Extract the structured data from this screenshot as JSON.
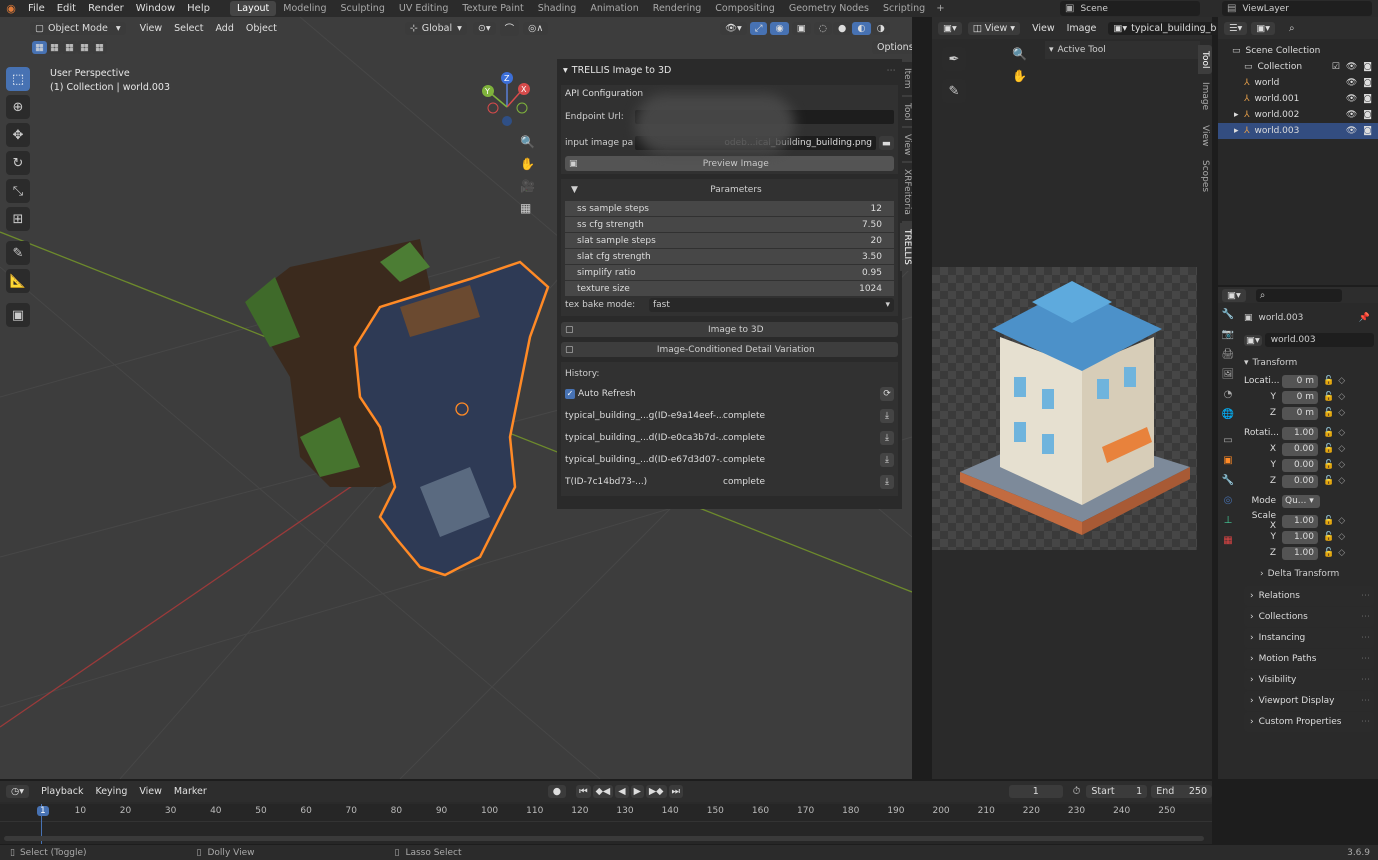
{
  "topbar": {
    "menus": [
      "File",
      "Edit",
      "Render",
      "Window",
      "Help"
    ],
    "workspaces": [
      "Layout",
      "Modeling",
      "Sculpting",
      "UV Editing",
      "Texture Paint",
      "Shading",
      "Animation",
      "Rendering",
      "Compositing",
      "Geometry Nodes",
      "Scripting"
    ],
    "scene": "Scene",
    "viewlayer": "ViewLayer"
  },
  "viewport": {
    "mode": "Object Mode",
    "menus": [
      "View",
      "Select",
      "Add",
      "Object"
    ],
    "transform": "Global",
    "options": "Options",
    "perspective": "User Perspective",
    "collection": "(1) Collection | world.003"
  },
  "npanel": {
    "title": "TRELLIS Image to 3D",
    "api_config": "API Configuration",
    "endpoint_label": "Endpoint Url:",
    "image_path_label": "input image pa",
    "image_path_value": "odeb...ical_building_building.png",
    "preview_button": "Preview Image",
    "parameters_label": "Parameters",
    "params": [
      {
        "label": "ss sample steps",
        "value": "12"
      },
      {
        "label": "ss cfg strength",
        "value": "7.50"
      },
      {
        "label": "slat sample steps",
        "value": "20"
      },
      {
        "label": "slat cfg strength",
        "value": "3.50"
      },
      {
        "label": "simplify ratio",
        "value": "0.95"
      },
      {
        "label": "texture size",
        "value": "1024"
      }
    ],
    "bake_label": "tex bake mode:",
    "bake_value": "fast",
    "image_to_3d": "Image to 3D",
    "detail_variation": "Image-Conditioned Detail Variation",
    "history_label": "History:",
    "auto_refresh": "Auto Refresh",
    "history": [
      {
        "name": "typical_building_...g(ID-e9a14eef-...)",
        "status": "complete"
      },
      {
        "name": "typical_building_...d(ID-e0ca3b7d-...)",
        "status": "complete"
      },
      {
        "name": "typical_building_...d(ID-e67d3d07-...)",
        "status": "complete"
      },
      {
        "name": "T(ID-7c14bd73-...)",
        "status": "complete"
      }
    ],
    "tabs": [
      "Item",
      "Tool",
      "View",
      "XRFeitoria",
      "TRELLIS"
    ]
  },
  "image_editor": {
    "view": "View",
    "menus": [
      "View",
      "Image"
    ],
    "image_name": "typical_building_b",
    "active_tool": "Active Tool",
    "tabs": [
      "Tool",
      "Image",
      "View",
      "Scopes"
    ]
  },
  "outliner": {
    "items": [
      {
        "label": "Scene Collection",
        "level": 0
      },
      {
        "label": "Collection",
        "level": 1
      },
      {
        "label": "world",
        "level": 1
      },
      {
        "label": "world.001",
        "level": 1
      },
      {
        "label": "world.002",
        "level": 1
      },
      {
        "label": "world.003",
        "level": 1
      }
    ]
  },
  "properties": {
    "object_name": "world.003",
    "data_name": "world.003",
    "transform": "Transform",
    "location_label": "Locati...",
    "rotation_label": "Rotati...",
    "mode_label": "Mode",
    "mode_value": "Qu...",
    "scale_label": "Scale X",
    "location": [
      {
        "axis": "",
        "value": "0 m"
      },
      {
        "axis": "Y",
        "value": "0 m"
      },
      {
        "axis": "Z",
        "value": "0 m"
      }
    ],
    "rotation": [
      {
        "axis": "",
        "value": "1.00"
      },
      {
        "axis": "X",
        "value": "0.00"
      },
      {
        "axis": "Y",
        "value": "0.00"
      },
      {
        "axis": "Z",
        "value": "0.00"
      }
    ],
    "scale": [
      {
        "axis": "",
        "value": "1.00"
      },
      {
        "axis": "Y",
        "value": "1.00"
      },
      {
        "axis": "Z",
        "value": "1.00"
      }
    ],
    "delta": "Delta Transform",
    "sections": [
      "Relations",
      "Collections",
      "Instancing",
      "Motion Paths",
      "Visibility",
      "Viewport Display",
      "Custom Properties"
    ]
  },
  "timeline": {
    "menus": [
      "Playback",
      "Keying",
      "View",
      "Marker"
    ],
    "current_frame": "1",
    "start_label": "Start",
    "start": "1",
    "end_label": "End",
    "end": "250",
    "ticks": [
      "1",
      "10",
      "20",
      "30",
      "40",
      "50",
      "60",
      "70",
      "80",
      "90",
      "100",
      "110",
      "120",
      "130",
      "140",
      "150",
      "160",
      "170",
      "180",
      "190",
      "200",
      "210",
      "220",
      "230",
      "240",
      "250"
    ]
  },
  "statusbar": {
    "select": "Select (Toggle)",
    "dolly": "Dolly View",
    "lasso": "Lasso Select",
    "version": "3.6.9"
  },
  "colors": {
    "accent": "#4772b3",
    "selected_outline": "#ff8a26",
    "bg": "#1d1d1d"
  }
}
